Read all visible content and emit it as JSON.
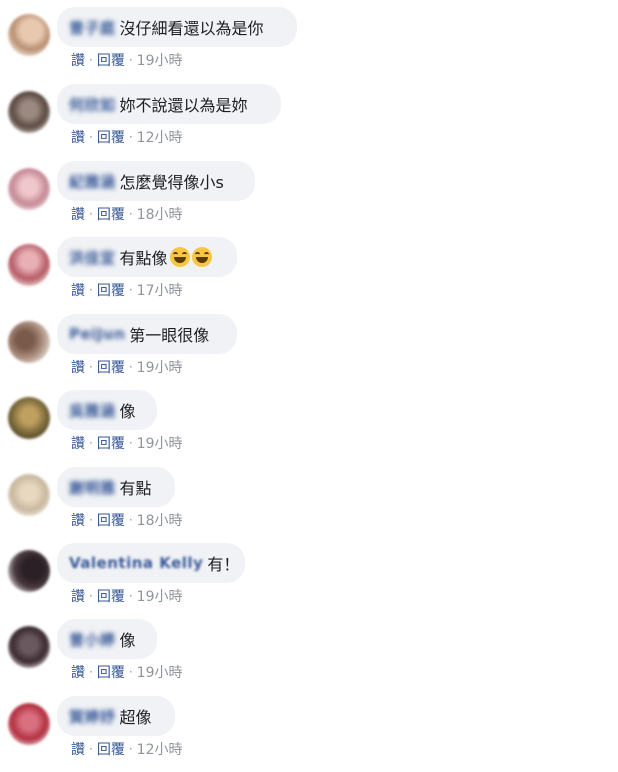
{
  "actions": {
    "like": "讚",
    "reply": "回覆"
  },
  "comments": [
    {
      "name": "曾子庭",
      "text": "沒仔細看還以為是你",
      "time": "19小時",
      "avatar_color": "#c9a58a"
    },
    {
      "name": "何欣如",
      "text": "妳不說還以為是妳",
      "time": "12小時",
      "avatar_color": "#6b5a50"
    },
    {
      "name": "紀雅涵",
      "text": "怎麼覺得像小s",
      "time": "18小時",
      "avatar_color": "#d9a0aa"
    },
    {
      "name": "洪佳宜",
      "text": "有點像",
      "emoji": "grinning-face",
      "time": "17小時",
      "avatar_color": "#b65c66"
    },
    {
      "name": "PeiJun",
      "text": "第一眼很像",
      "time": "19小時",
      "avatar_color": "#8a6a5a"
    },
    {
      "name": "吳雅涵",
      "text": "像",
      "time": "19小時",
      "avatar_color": "#7a6a3a"
    },
    {
      "name": "謝明雅",
      "text": "有點",
      "time": "18小時",
      "avatar_color": "#c8b8a0"
    },
    {
      "name": "Valentina Kelly",
      "text": "有！",
      "time": "19小時",
      "avatar_color": "#4a3a40"
    },
    {
      "name": "曾小婷",
      "text": "像",
      "time": "19小時",
      "avatar_color": "#3a2a30"
    },
    {
      "name": "賀婷妤",
      "text": "超像",
      "time": "12小時",
      "avatar_color": "#b23040"
    }
  ]
}
